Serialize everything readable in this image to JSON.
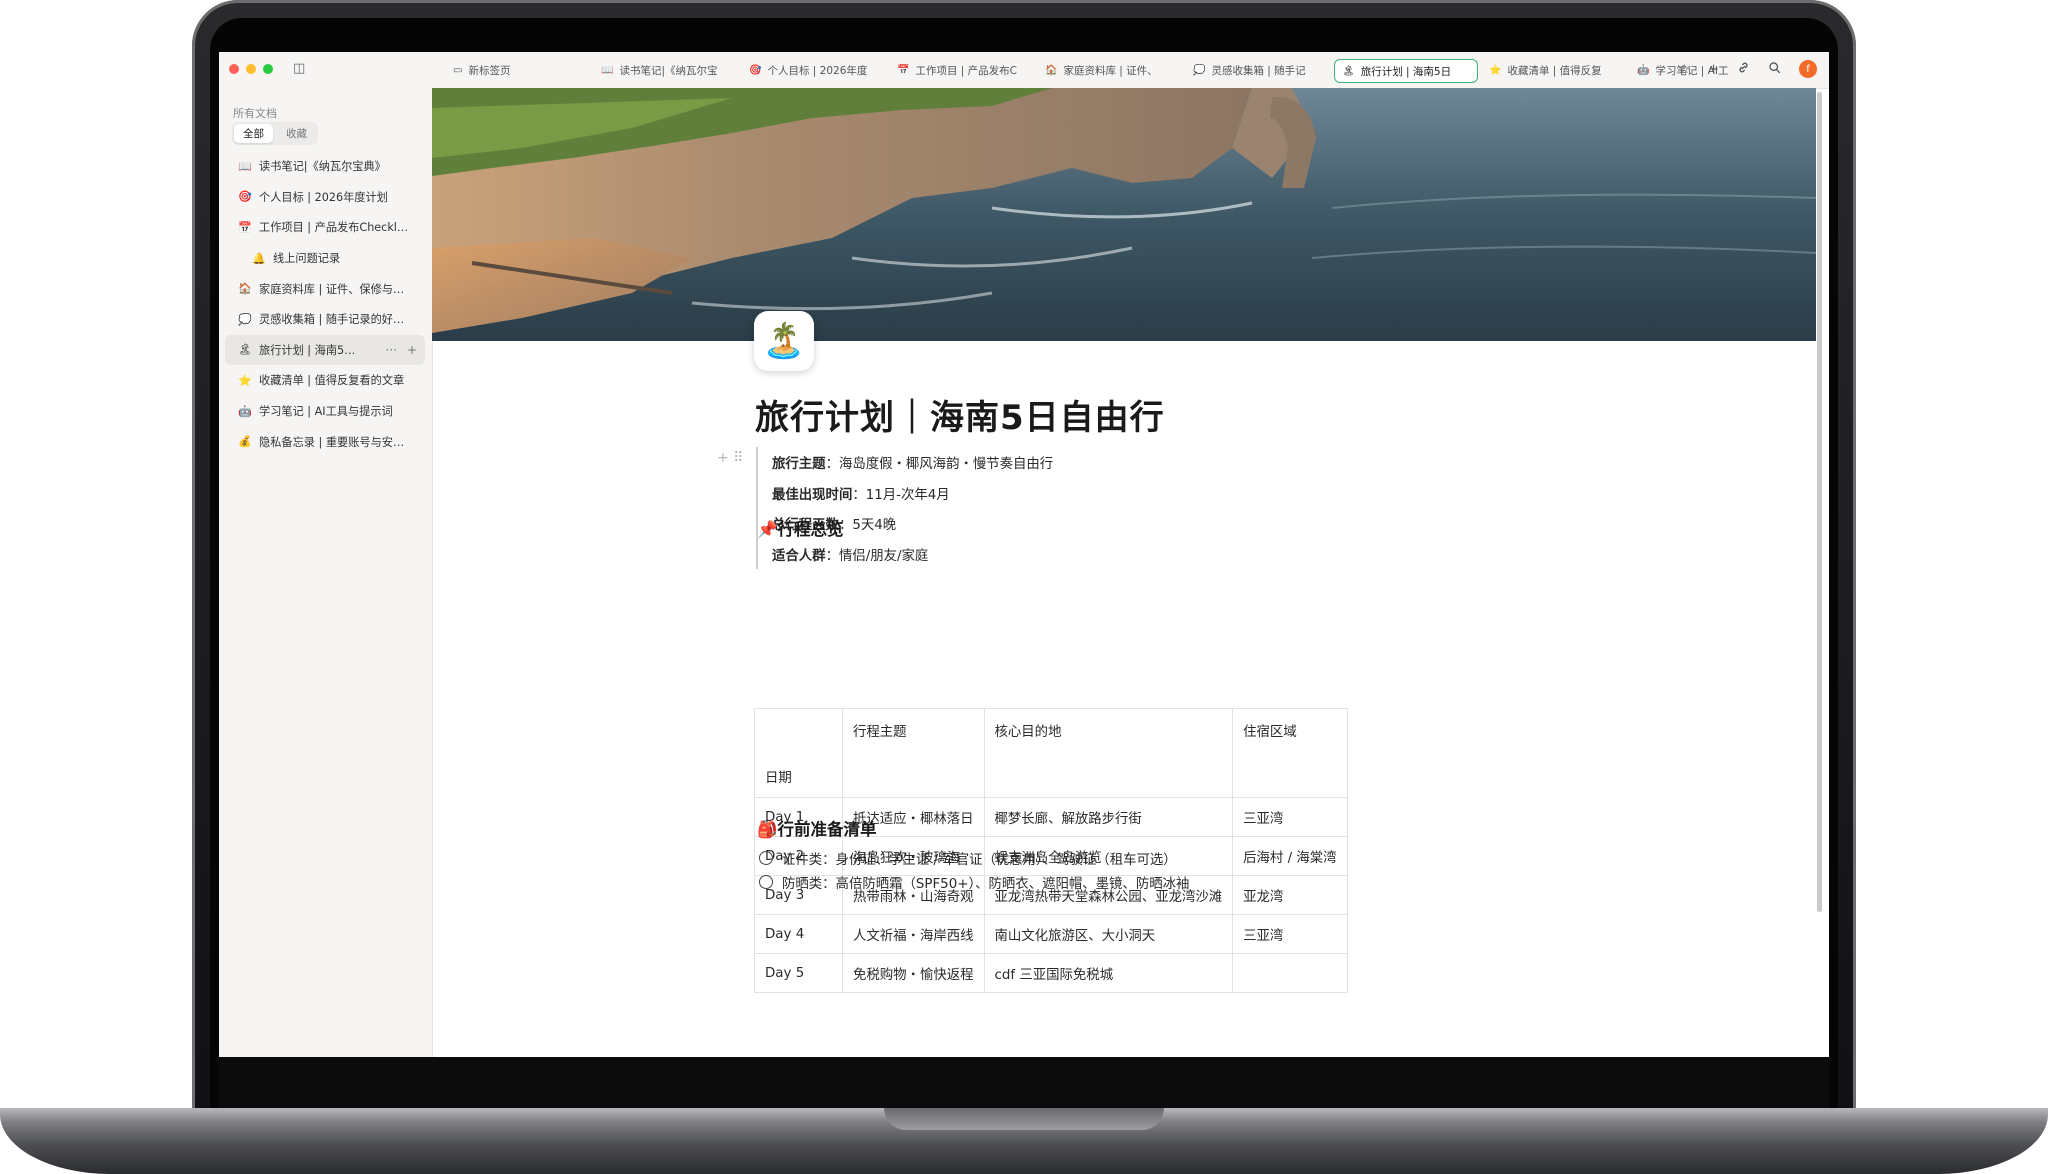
{
  "sidebar": {
    "caption": "所有文档",
    "segments": [
      "全部",
      "收藏"
    ],
    "items": [
      {
        "icon": "📖",
        "label": "读书笔记|《纳瓦尔宝典》"
      },
      {
        "icon": "🎯",
        "label": "个人目标 | 2026年度计划"
      },
      {
        "icon": "📅",
        "label": "工作项目 | 产品发布Checklist"
      },
      {
        "icon": "🔔",
        "label": "线上问题记录",
        "indent": true
      },
      {
        "icon": "🏠",
        "label": "家庭资料库 | 证件、保修与账单"
      },
      {
        "icon": "💭",
        "label": "灵感收集箱 | 随手记录的好点子"
      },
      {
        "icon": "🏝",
        "label": "旅行计划 | 海南5日...",
        "active": true
      },
      {
        "icon": "⭐",
        "label": "收藏清单 | 值得反复看的文章"
      },
      {
        "icon": "🤖",
        "label": "学习笔记 | AI工具与提示词"
      },
      {
        "icon": "💰",
        "label": "隐私备忘录 | 重要账号与安全..."
      }
    ],
    "item_actions": [
      "···",
      "+"
    ]
  },
  "tabs": [
    {
      "icon": "▭",
      "label": "新标签页"
    },
    {
      "icon": "📖",
      "label": "读书笔记|《纳瓦尔宝"
    },
    {
      "icon": "🎯",
      "label": "个人目标 | 2026年度"
    },
    {
      "icon": "📅",
      "label": "工作项目 | 产品发布C"
    },
    {
      "icon": "🏠",
      "label": "家庭资料库 | 证件、"
    },
    {
      "icon": "💭",
      "label": "灵感收集箱 | 随手记"
    },
    {
      "icon": "🏝",
      "label": "旅行计划 | 海南5日",
      "active": true
    },
    {
      "icon": "⭐",
      "label": "收藏清单 | 值得反复"
    },
    {
      "icon": "🤖",
      "label": "学习笔记 | AI工"
    }
  ],
  "toolbar": {
    "star": "☆",
    "plus": "+",
    "link": "🔗",
    "search": "⌕",
    "avatar": "f"
  },
  "page": {
    "icon": "🏝️",
    "title": "旅行计划｜海南5日自由行",
    "handle_plus": "+",
    "handle_drag": "⠿",
    "info": [
      {
        "key": "旅行主题",
        "value": "：海岛度假・椰风海韵・慢节奏自由行"
      },
      {
        "key": "最佳出现时间",
        "value": "：11月-次年4月"
      },
      {
        "key": "总行程天数",
        "value": "：5天4晚"
      },
      {
        "key": "适合人群",
        "value": "：情侣/朋友/家庭"
      }
    ],
    "section_overview": "📌行程总览",
    "table": {
      "headers": [
        "日期",
        "行程主题",
        "核心目的地",
        "住宿区域"
      ],
      "rows": [
        [
          "Day 1",
          "抵达适应・椰林落日",
          "椰梦长廊、解放路步行街",
          "三亚湾"
        ],
        [
          "Day 2",
          "海岛狂欢・玻璃海",
          "蜈支洲岛全岛游览",
          "后海村 / 海棠湾"
        ],
        [
          "Day 3",
          "热带雨林・山海奇观",
          "亚龙湾热带天堂森林公园、亚龙湾沙滩",
          "亚龙湾"
        ],
        [
          "Day 4",
          "人文祈福・海岸西线",
          "南山文化旅游区、大小洞天",
          "三亚湾"
        ],
        [
          "Day 5",
          "免税购物・愉快返程",
          "cdf 三亚国际免税城",
          ""
        ]
      ]
    },
    "section_prep": "🎒行前准备清单",
    "checklist": [
      "证件类：身份证、学生证 / 军官证（优惠用）、驾驶证（租车可选）",
      "防晒类：高倍防晒霜（SPF50+）、防晒衣、遮阳帽、墨镜、防晒冰袖"
    ]
  }
}
